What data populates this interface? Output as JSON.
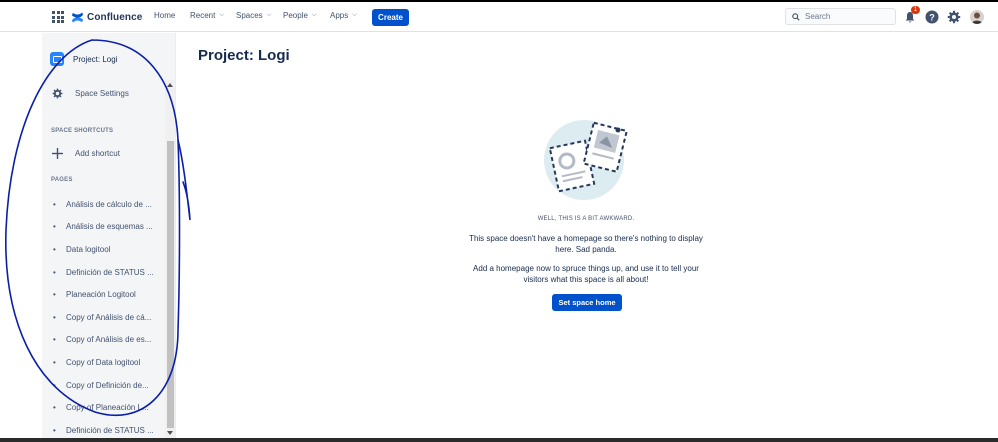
{
  "topnav": {
    "product_name": "Confluence",
    "items": [
      {
        "label": "Home",
        "has_menu": false
      },
      {
        "label": "Recent",
        "has_menu": true
      },
      {
        "label": "Spaces",
        "has_menu": true
      },
      {
        "label": "People",
        "has_menu": true
      },
      {
        "label": "Apps",
        "has_menu": true
      }
    ],
    "create_label": "Create",
    "search_placeholder": "Search",
    "notification_count": "1",
    "icons": [
      "app-switcher-icon",
      "notifications-icon",
      "help-icon",
      "settings-icon",
      "avatar"
    ]
  },
  "sidebar": {
    "space_name": "Project: Logi",
    "settings_label": "Space Settings",
    "shortcuts_heading": "SPACE SHORTCUTS",
    "add_shortcut_label": "Add shortcut",
    "pages_heading": "PAGES",
    "pages": [
      "Análisis de cálculo de ...",
      "Análisis de esquemas ...",
      "Data logitool",
      "Definición de STATUS ...",
      "Planeación Logitool",
      "Copy of Análisis de cá...",
      "Copy of Análisis de es...",
      "Copy of Data logitool",
      "Copy of Definición de...",
      "Copy of Planeación L...",
      "Definición de STATUS ..."
    ]
  },
  "main": {
    "title": "Project: Logi",
    "empty_heading": "WELL, THIS IS A BIT AWKWARD.",
    "empty_text_1": "This space doesn't have a homepage so there's nothing to display here. Sad panda.",
    "empty_text_2": "Add a homepage now to spruce things up, and use it to tell your visitors what this space is all about!",
    "set_home_label": "Set space home"
  },
  "colors": {
    "brand_blue": "#0052cc",
    "sidebar_bg": "#f4f5f7",
    "text": "#172b4d",
    "badge_red": "#de350b",
    "annotation_ink": "#0a1fa6"
  }
}
